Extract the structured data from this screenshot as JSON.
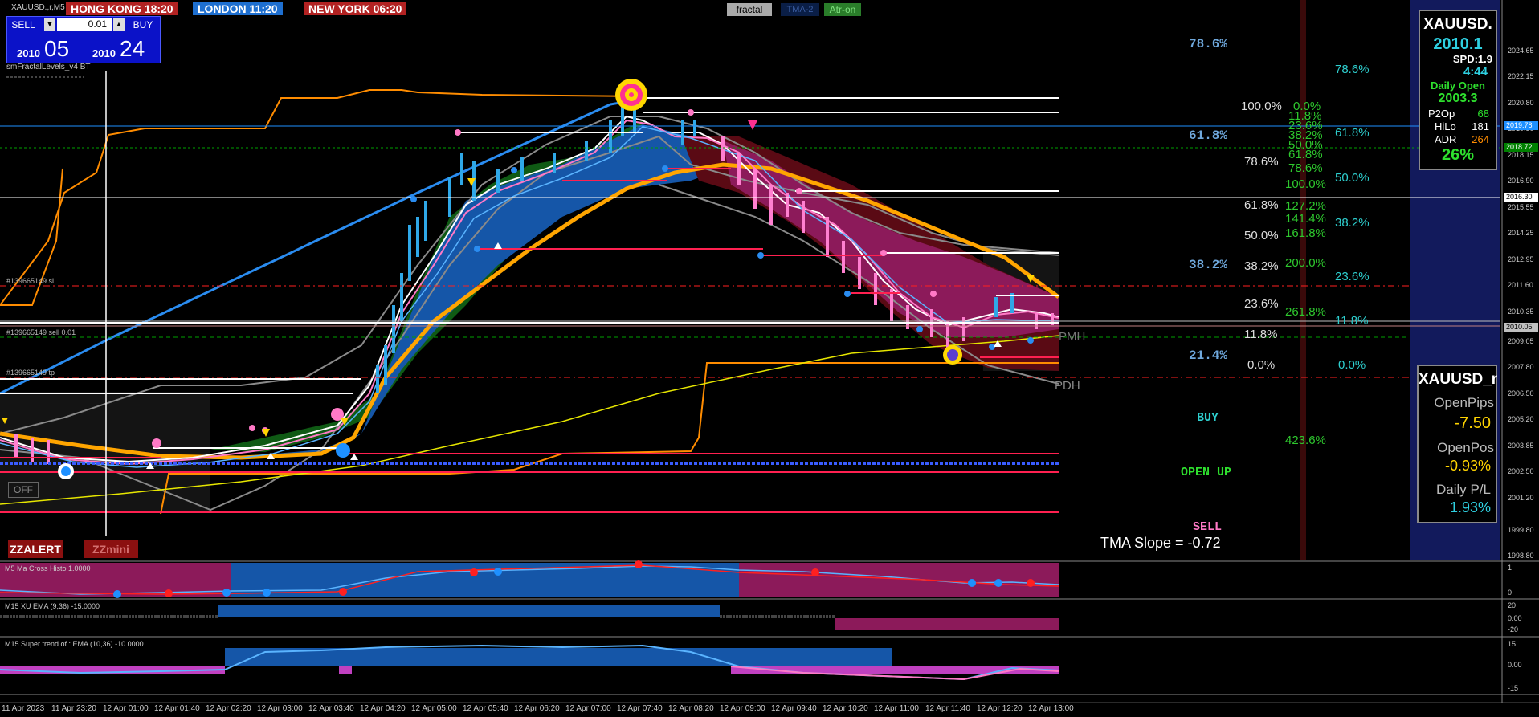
{
  "symbol_title": "XAUUSD.,r,M5",
  "clocks": [
    {
      "label": "HONG KONG 18:20",
      "color": "#b22222"
    },
    {
      "label": "LONDON  11:20",
      "color": "#1e6fd0"
    },
    {
      "label": "NEW YORK  06:20",
      "color": "#b22222"
    }
  ],
  "top_buttons": {
    "fractal": "fractal",
    "tma": "TMA-2",
    "atr": "Atr-on"
  },
  "trade_panel": {
    "sell_label": "SELL",
    "buy_label": "BUY",
    "lot_value": "0.01",
    "sell_price_small": "2010",
    "sell_price_big": "05",
    "buy_price_small": "2010",
    "buy_price_big": "24"
  },
  "indicator_label": "smFractalLevels_v4 BT",
  "order_labels": {
    "sl": "#139665149 sl",
    "sell": "#139665149 sell 0.01",
    "tp": "#139665149 tp"
  },
  "off_button": "OFF",
  "zz_buttons": {
    "alert": "ZZALERT",
    "mini": "ZZmini"
  },
  "fib_left": [
    "78.6%",
    "61.8%",
    "38.2%",
    "21.4%"
  ],
  "fib_mid": [
    "100.0%",
    "78.6%",
    "61.8%",
    "50.0%",
    "38.2%",
    "23.6%",
    "11.8%",
    "0.0%"
  ],
  "fib_green": [
    "0.0%",
    "11.8%",
    "23.6%",
    "38.2%",
    "50.0%",
    "61.8%",
    "78.6%",
    "100.0%",
    "127.2%",
    "141.4%",
    "161.8%",
    "200.0%",
    "261.8%",
    "423.6%"
  ],
  "fib_cyan": [
    "78.6%",
    "61.8%",
    "50.0%",
    "38.2%",
    "23.6%",
    "11.8%",
    "0.0%"
  ],
  "signals": {
    "buy": "BUY",
    "open_up": "OPEN UP",
    "sell": "SELL",
    "tma_slope": "TMA Slope = -0.72"
  },
  "line_tags": {
    "pmh": "PMH",
    "pdh": "PDH"
  },
  "info_box": {
    "symbol": "XAUUSD.",
    "price": "2010.1",
    "spread": "SPD:1.9",
    "time": "4:44",
    "daily_open_label": "Daily Open",
    "daily_open": "2003.3",
    "rows": [
      {
        "label": "P2Op",
        "value": "68",
        "color": "#00e000"
      },
      {
        "label": "HiLo",
        "value": "181",
        "color": "#ffffff"
      },
      {
        "label": "ADR",
        "value": "264",
        "color": "#ff8c00"
      }
    ],
    "adr_pct": "26%"
  },
  "pos_box": {
    "symbol": "XAUUSD_r",
    "open_pips_label": "OpenPips",
    "open_pips": "-7.50",
    "open_pos_label": "OpenPos",
    "open_pos": "-0.93%",
    "daily_pl_label": "Daily P/L",
    "daily_pl": "1.93%"
  },
  "price_axis": [
    "2024.65",
    "2022.15",
    "2020.80",
    "2019.50",
    "2018.15",
    "2016.90",
    "2015.55",
    "2014.25",
    "2012.95",
    "2011.60",
    "2010.35",
    "2009.05",
    "2007.80",
    "2006.50",
    "2005.20",
    "2003.85",
    "2002.50",
    "2001.20",
    "1999.80",
    "1998.80"
  ],
  "price_tags": [
    {
      "value": "2019.78",
      "color": "#1e90ff"
    },
    {
      "value": "2018.72",
      "color": "#008000"
    },
    {
      "value": "2016.30",
      "color": "#ffffff"
    },
    {
      "value": "2010.05",
      "color": "#c0c0c0"
    }
  ],
  "sub_panels": [
    {
      "title": "M5 Ma Cross Histo 1.0000",
      "axis": [
        "1",
        "0"
      ]
    },
    {
      "title": "M15 XU EMA (9,36) -15.0000",
      "axis": [
        "20",
        "0.00",
        "-20"
      ]
    },
    {
      "title": "M15  Super trend of : EMA (10,36) -10.0000",
      "axis": [
        "15",
        "0.00",
        "-15"
      ]
    }
  ],
  "time_axis": [
    "11 Apr 2023",
    "11 Apr 23:20",
    "12 Apr 01:00",
    "12 Apr 01:40",
    "12 Apr 02:20",
    "12 Apr 03:00",
    "12 Apr 03:40",
    "12 Apr 04:20",
    "12 Apr 05:00",
    "12 Apr 05:40",
    "12 Apr 06:20",
    "12 Apr 07:00",
    "12 Apr 07:40",
    "12 Apr 08:20",
    "12 Apr 09:00",
    "12 Apr 09:40",
    "12 Apr 10:20",
    "12 Apr 11:00",
    "12 Apr 11:40",
    "12 Apr 12:20",
    "12 Apr 13:00"
  ]
}
